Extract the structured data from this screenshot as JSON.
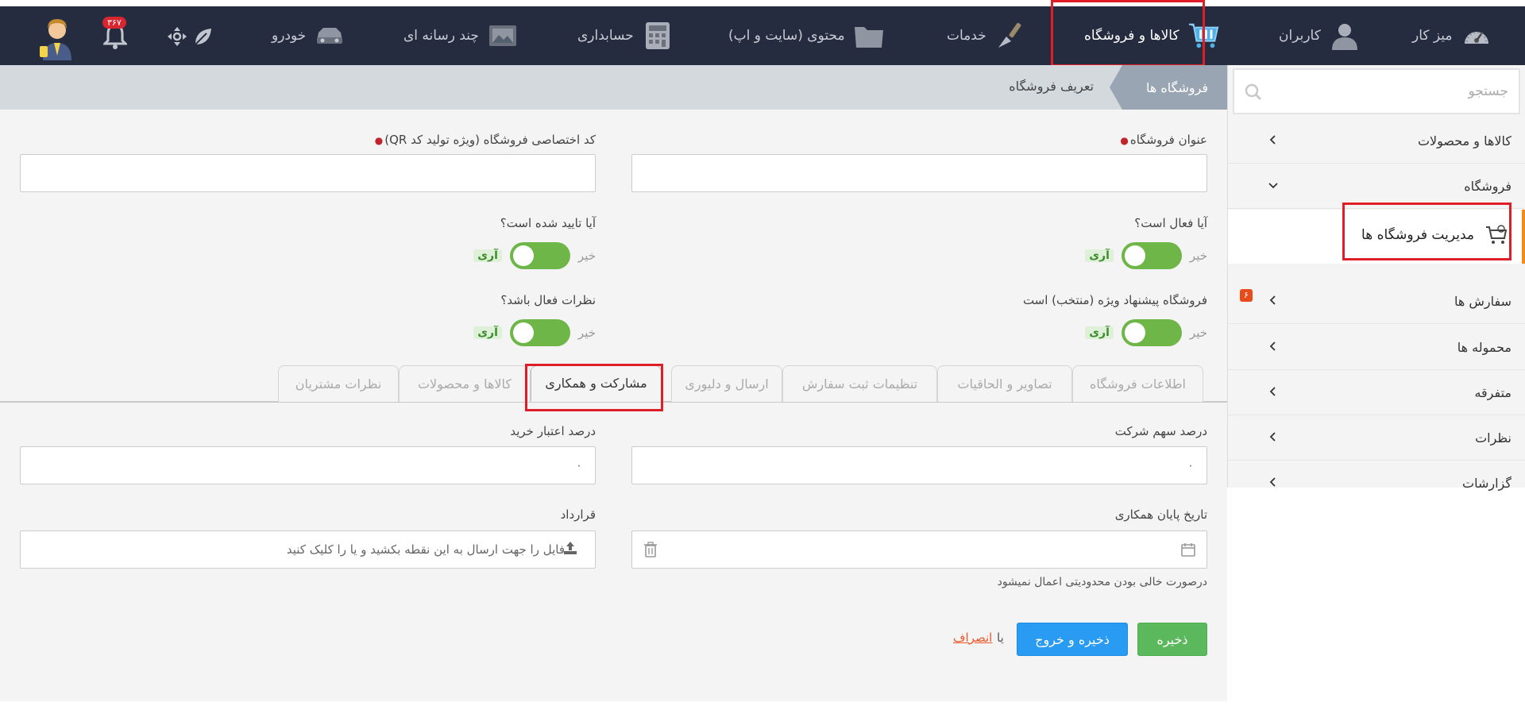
{
  "topnav": {
    "items": [
      {
        "label": "میز کار",
        "icon": "gauge-icon"
      },
      {
        "label": "کاربران",
        "icon": "user-icon"
      },
      {
        "label": "کالاها و فروشگاه",
        "icon": "cart-icon",
        "active": true
      },
      {
        "label": "خدمات",
        "icon": "brush-icon"
      },
      {
        "label": "محتوی (سایت و اپ)",
        "icon": "folder-icon"
      },
      {
        "label": "حسابداری",
        "icon": "calculator-icon"
      },
      {
        "label": "چند رسانه ای",
        "icon": "image-icon"
      },
      {
        "label": "خودرو",
        "icon": "car-icon"
      }
    ],
    "notification_count": "۳۶۷"
  },
  "sidebar": {
    "search_placeholder": "جستجو",
    "items": [
      {
        "label": "کالاها و محصولات"
      },
      {
        "label": "فروشگاه"
      },
      {
        "label": "مدیریت فروشگاه ها"
      },
      {
        "label": "سفارش ها",
        "badge": "۶"
      },
      {
        "label": "محموله ها"
      },
      {
        "label": "متفرقه"
      },
      {
        "label": "نظرات"
      },
      {
        "label": "گزارشات"
      }
    ]
  },
  "breadcrumb": {
    "current": "فروشگاه ها",
    "page": "تعریف فروشگاه"
  },
  "form": {
    "store_title_label": "عنوان فروشگاه",
    "store_title_value": "",
    "store_code_label": "کد اختصاصی فروشگاه (ویژه تولید کد QR)",
    "store_code_value": "",
    "is_active_label": "آیا فعال است؟",
    "is_approved_label": "آیا تایید شده است؟",
    "is_featured_label": "فروشگاه پیشنهاد ویژه (منتخب) است",
    "comments_active_label": "نظرات فعال باشد؟",
    "toggle_no": "خیر",
    "toggle_yes": "آری"
  },
  "tabs": [
    {
      "label": "اطلاعات فروشگاه"
    },
    {
      "label": "تصاویر و الحاقیات"
    },
    {
      "label": "تنظیمات ثبت سفارش"
    },
    {
      "label": "ارسال و دلیوری"
    },
    {
      "label": "مشارکت و همکاری",
      "active": true
    },
    {
      "label": "کالاها و محصولات"
    },
    {
      "label": "نظرات مشتریان"
    }
  ],
  "partnership": {
    "company_share_label": "درصد سهم شرکت",
    "company_share_value": "۰",
    "purchase_credit_label": "درصد اعتبار خرید",
    "purchase_credit_value": "۰",
    "end_date_label": "تاریخ پایان همکاری",
    "end_date_help": "درصورت خالی بودن محدودیتی اعمال نمیشود",
    "contract_label": "قرارداد",
    "contract_upload_text": "فایل را جهت ارسال به این نقطه بکشید و یا  را کلیک کنید"
  },
  "actions": {
    "save": "ذخیره",
    "save_exit": "ذخیره و خروج",
    "or": "یا",
    "cancel": "انصراف"
  },
  "colors": {
    "topbar": "#262c40",
    "highlight": "#e01e2a",
    "toggle_on": "#6fb648",
    "save": "#5cb85c",
    "save_exit": "#2a9bf3"
  }
}
